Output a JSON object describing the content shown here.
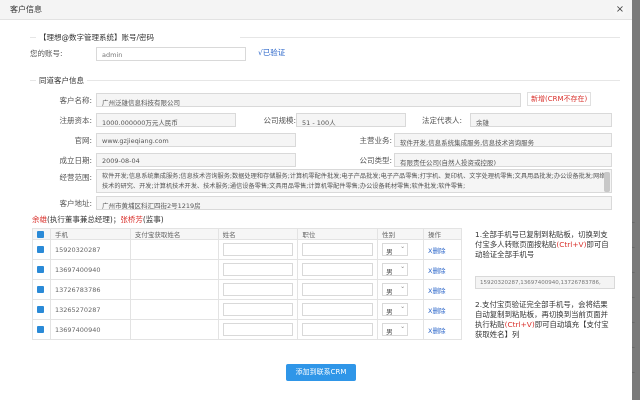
{
  "window": {
    "title": "客户信息"
  },
  "backdrop": {
    "labels": [
      "广",
      "广",
      "广",
      "广",
      "广",
      "广",
      "广"
    ]
  },
  "account": {
    "legend": "【理想@数字管理系统】账号/密码",
    "label": "您的账号:",
    "value": "admin",
    "verified": "√已验证"
  },
  "customer": {
    "legend": "同道客户信息",
    "name_label": "客户名称:",
    "name_value": "广州泛雄信息科技有限公司",
    "new_button": "新增(CRM不存在)",
    "capital_label": "注册资本:",
    "capital_value": "1000.000000万元人民币",
    "scale_label": "公司规模:",
    "scale_value": "51 - 100人",
    "legal_label": "法定代表人:",
    "legal_value": "余雄",
    "website_label": "官网:",
    "website_value": "www.gzjieqiang.com",
    "business_label": "主营业务:",
    "business_value": "软件开发,信息系统集成服务,信息技术咨询服务",
    "founded_label": "成立日期:",
    "founded_value": "2009-08-04",
    "type_label": "公司类型:",
    "type_value": "有限责任公司(自然人投资或控股)",
    "scope_label": "经营范围:",
    "scope_value": "软件开发;信息系统集成服务;信息技术咨询服务;数据处理和存储服务;计算机零配件批发;电子产品批发;电子产品零售;打字机、复印机、文字处理机零售;文具用品批发;办公设备批发;网络技术的研究、开发;计算机技术开发、技术服务;通信设备零售;文具用品零售;计算机零配件零售;办公设备耗材零售;软件批发;软件零售;",
    "address_label": "客户地址:",
    "address_value": "广州市黄埔区科汇四街2号1219房"
  },
  "contacts": {
    "lead_name": "余雄",
    "lead_role": "(执行董事兼总经理)",
    "separator": "；",
    "second_name": "张桥芳",
    "second_role": "(监事)",
    "headers": {
      "phone": "手机",
      "alipay": "支付宝获取姓名",
      "name": "姓名",
      "position": "职位",
      "gender": "性别",
      "action": "操作"
    },
    "rows": [
      {
        "phone": "15920320287",
        "gender": "男",
        "action": "X删除"
      },
      {
        "phone": "13697400940",
        "gender": "男",
        "action": "X删除"
      },
      {
        "phone": "13726783786",
        "gender": "男",
        "action": "X删除"
      },
      {
        "phone": "13265270287",
        "gender": "男",
        "action": "X删除"
      },
      {
        "phone": "13697400940",
        "gender": "男",
        "action": "X删除"
      }
    ]
  },
  "tips": {
    "step1_a": "1.全部手机号已复制到粘贴板，切换到支付宝多人转账页面按粘贴",
    "step1_key": "(Ctrl+V)",
    "step1_b": "即可自动验证全部手机号",
    "copy_value": "15920320287,13697400940,13726783786,",
    "step2_a": "2.支付宝页验证完全部手机号，会将结果自动复制到粘贴板，再切换到当前页面并执行粘贴",
    "step2_key": "(Ctrl+V)",
    "step2_b": "即可自动填充【支付宝获取姓名】列"
  },
  "submit_label": "添加到联系CRM"
}
